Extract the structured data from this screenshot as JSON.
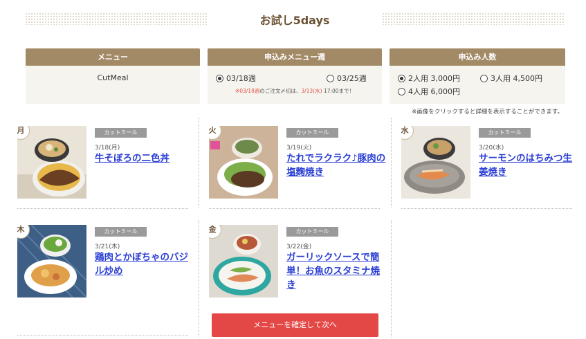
{
  "title": "お試し5days",
  "options": {
    "menu": {
      "header": "メニュー",
      "value": "CutMeal"
    },
    "week": {
      "header": "申込みメニュー週",
      "choices": [
        "03/18週",
        "03/25週"
      ],
      "selected": "03/18週",
      "deadline_prefix": "※",
      "deadline_red1": "03/18週",
      "deadline_mid": "のご注文〆切は、",
      "deadline_red2": "3/13(水)",
      "deadline_suffix": " 17:00まで！"
    },
    "people": {
      "header": "申込み人数",
      "choices": [
        "2人用 3,000円",
        "3人用 4,500円",
        "4人用 6,000円"
      ],
      "selected": "2人用 3,000円"
    }
  },
  "note": "※画像をクリックすると詳細を表示することができます。",
  "meals": [
    {
      "day": "月",
      "tag": "カットミール",
      "date": "3/18(月)",
      "name": "牛そぼろの二色丼"
    },
    {
      "day": "火",
      "tag": "カットミール",
      "date": "3/19(火)",
      "name": "たれでラクラク♪豚肉の塩麹焼き"
    },
    {
      "day": "水",
      "tag": "カットミール",
      "date": "3/20(水)",
      "name": "サーモンのはちみつ生姜焼き"
    },
    {
      "day": "木",
      "tag": "カットミール",
      "date": "3/21(木)",
      "name": "鶏肉とかぼちゃのバジル炒め"
    },
    {
      "day": "金",
      "tag": "カットミール",
      "date": "3/22(金)",
      "name": "ガーリックソースで簡単！お魚のスタミナ焼き"
    }
  ],
  "next_button": "メニューを確定して次へ",
  "colors": {
    "header_bg": "#a38a66",
    "title": "#6b5233",
    "button": "#e34846",
    "link": "#2b3fd4"
  }
}
